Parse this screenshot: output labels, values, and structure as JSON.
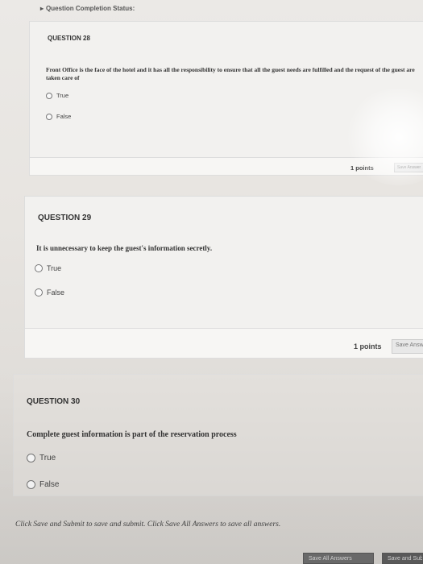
{
  "status_bar": {
    "bullet": "▸",
    "label": "Question Completion Status:"
  },
  "questions": [
    {
      "number_label": "QUESTION 28",
      "text": "Front Office is the face of the hotel and it has all the responsibility to ensure that all the guest needs are fulfilled and the request of the guest are taken care of",
      "options": [
        "True",
        "False"
      ],
      "points": "1 points",
      "save_label": "Save Answer"
    },
    {
      "number_label": "QUESTION 29",
      "text": "It is unnecessary to keep the guest's information secretly.",
      "options": [
        "True",
        "False"
      ],
      "points": "1 points",
      "save_label": "Save Answer"
    },
    {
      "number_label": "QUESTION 30",
      "text": "Complete guest information is part of the reservation process",
      "options": [
        "True",
        "False"
      ]
    }
  ],
  "footer": {
    "instruction": "Click Save and Submit to save and submit. Click Save All Answers to save all answers.",
    "save_all_label": "Save All Answers",
    "save_submit_label": "Save and Submit"
  }
}
